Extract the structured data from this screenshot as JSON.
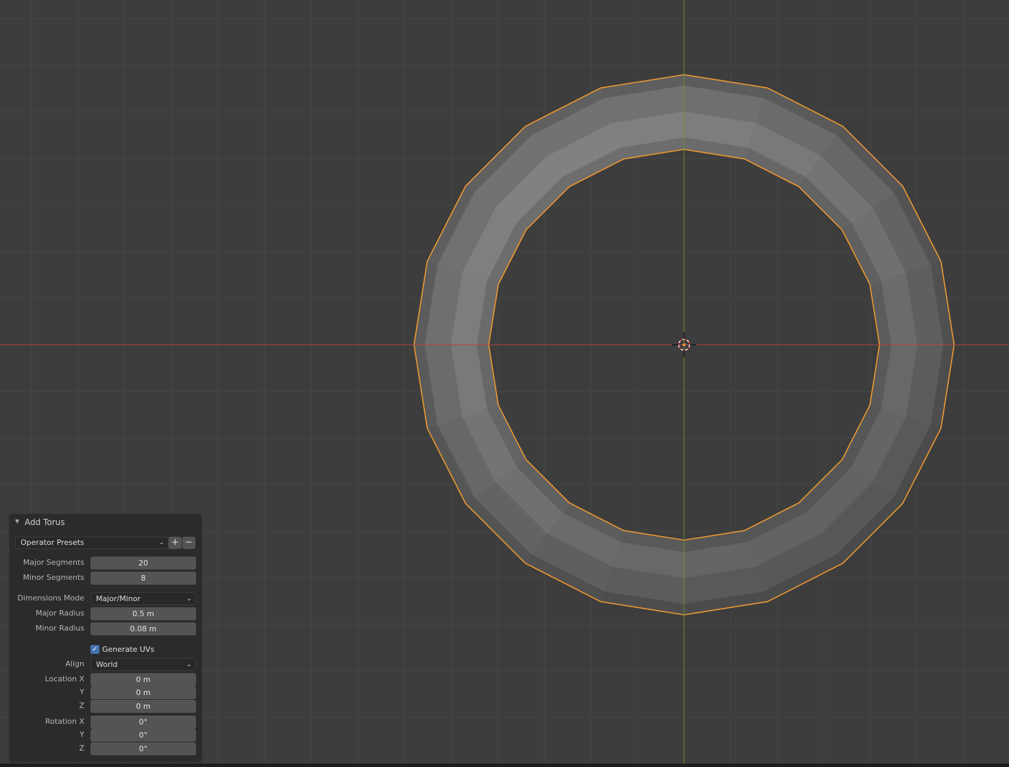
{
  "panel": {
    "title": "Add Torus",
    "presets_label": "Operator Presets",
    "add_preset_symbol": "+",
    "remove_preset_symbol": "−",
    "fields": [
      {
        "label": "Major Segments",
        "value": "20"
      },
      {
        "label": "Minor Segments",
        "value": "8"
      },
      {
        "label": "Dimensions Mode",
        "value": "Major/Minor"
      },
      {
        "label": "Major Radius",
        "value": "0.5 m"
      },
      {
        "label": "Minor Radius",
        "value": "0.08 m"
      },
      {
        "label": "Generate UVs",
        "checked": true
      },
      {
        "label": "Align",
        "value": "World"
      },
      {
        "label": "Location X",
        "value": "0 m"
      },
      {
        "label": "Y",
        "value": "0 m"
      },
      {
        "label": "Z",
        "value": "0 m"
      },
      {
        "label": "Rotation X",
        "value": "0°"
      },
      {
        "label": "Y",
        "value": "0°"
      },
      {
        "label": "Z",
        "value": "0°"
      }
    ]
  },
  "viewport": {
    "object": "torus",
    "major_segments": 20,
    "minor_segments": 8,
    "selected": true,
    "colors": {
      "background": "#3d3d3d",
      "grid": "#474747",
      "x_axis": "#b34444",
      "y_axis": "#6b8f2e",
      "selection_outline": "#f09a32",
      "mesh_light": "#8a8a8a",
      "mesh_dark": "#5f5f5f",
      "panel_bg": "#2b2b2b",
      "field_bg": "#545454",
      "checkbox": "#4772b3"
    }
  }
}
